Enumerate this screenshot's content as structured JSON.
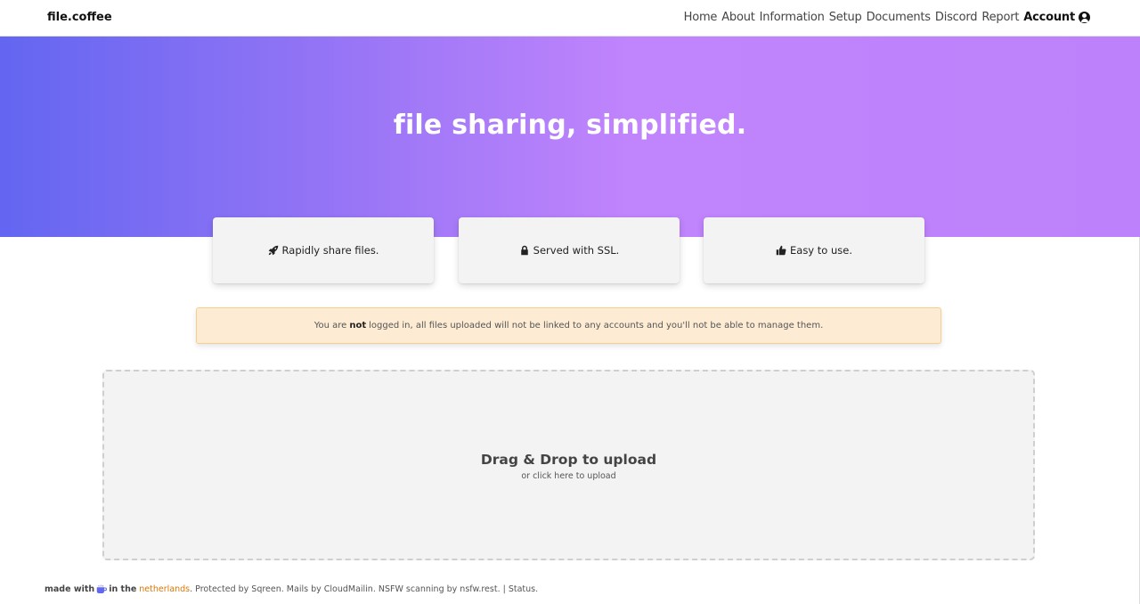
{
  "brand": "file.coffee",
  "nav": {
    "home": "Home",
    "about": "About",
    "information": "Information",
    "setup": "Setup",
    "documents": "Documents",
    "discord": "Discord",
    "report": "Report",
    "account": "Account"
  },
  "hero": {
    "title": "file sharing, simplified."
  },
  "features": [
    {
      "icon": "rocket-icon",
      "label": "Rapidly share files."
    },
    {
      "icon": "lock-icon",
      "label": "Served with SSL."
    },
    {
      "icon": "thumbs-up-icon",
      "label": "Easy to use."
    }
  ],
  "alert": {
    "prefix": "You are",
    "emphasis": "not",
    "suffix": "logged in, all files uploaded will not be linked to any accounts and you'll not be able to manage them."
  },
  "dropzone": {
    "title": "Drag & Drop to upload",
    "subtitle": "or click here to upload"
  },
  "footer": {
    "made_with": "made with",
    "in_the": "in the",
    "country": "netherlands",
    "protected": ". Protected by Sqreen.",
    "mails": "Mails by CloudMailin.",
    "nsfw": "NSFW scanning by nsfw.rest.",
    "status": "| Status."
  },
  "colors": {
    "hero_start": "#6366f1",
    "hero_end": "#c084fc",
    "alert_bg": "#fdebd3",
    "alert_border": "#f6cf8f",
    "country_link": "#d97706"
  }
}
